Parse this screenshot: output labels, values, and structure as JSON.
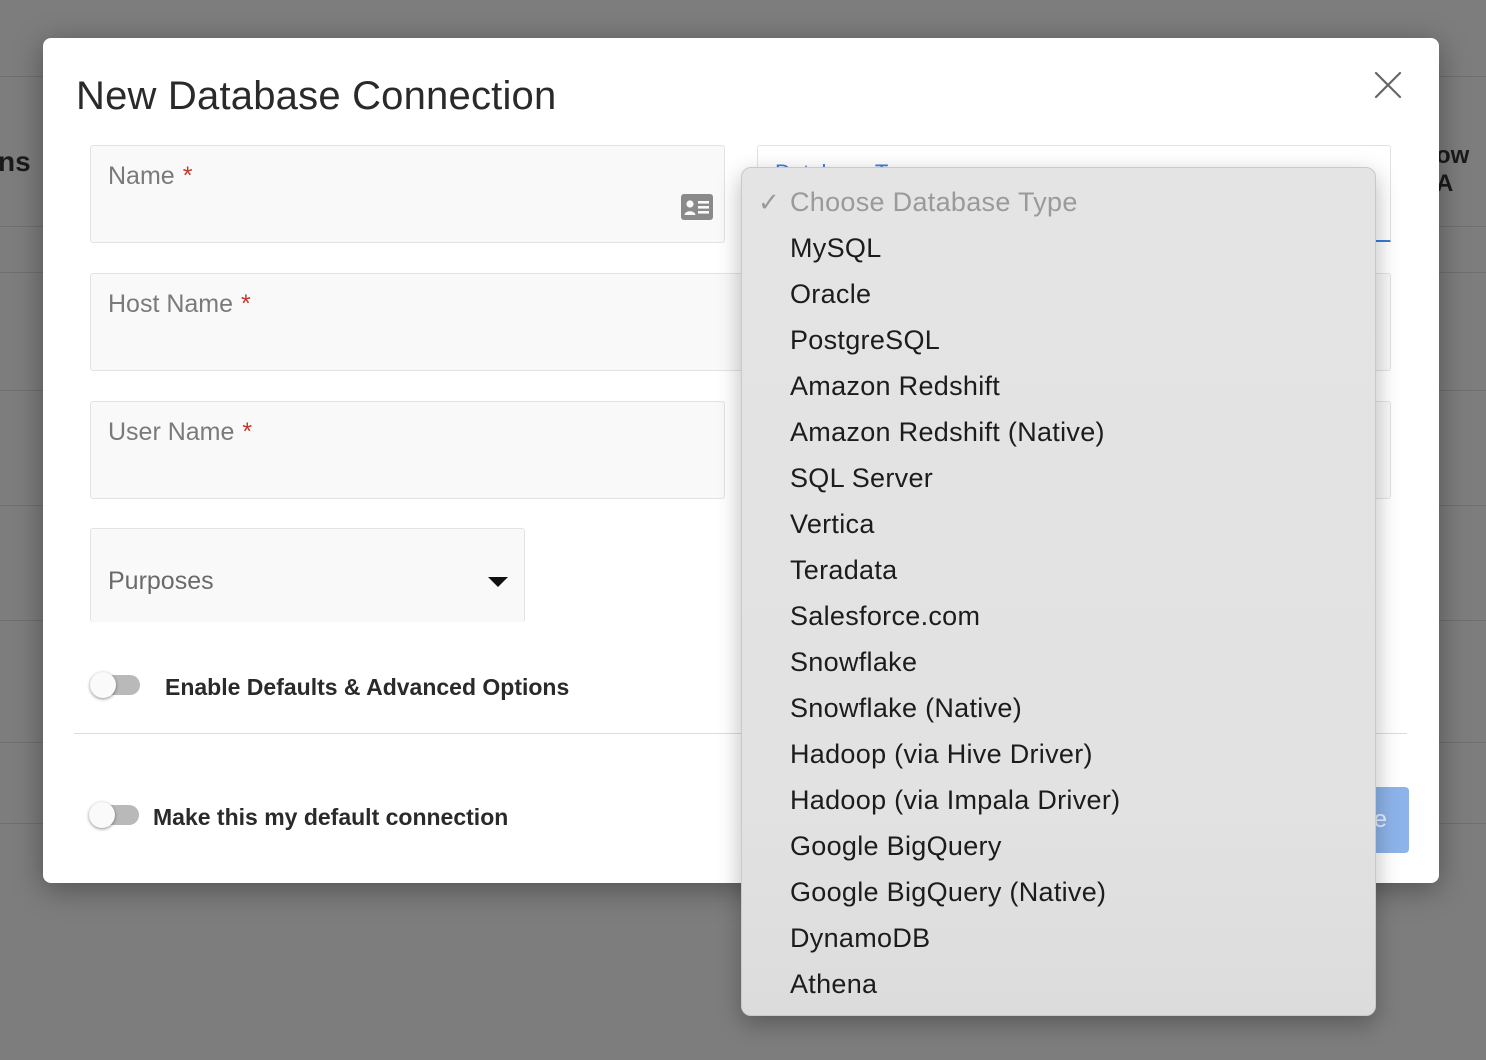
{
  "background": {
    "left_fragment": "ns",
    "right_fragment": "ow A"
  },
  "modal": {
    "title": "New Database Connection",
    "close_icon": "close-icon"
  },
  "form": {
    "name": {
      "label": "Name",
      "required": "*",
      "icon": "id-card-icon"
    },
    "host_name": {
      "label": "Host Name",
      "required": "*"
    },
    "user_name": {
      "label": "User Name",
      "required": "*"
    },
    "database_type": {
      "label": "Database Type"
    },
    "purposes": {
      "label": "Purposes"
    }
  },
  "toggles": {
    "advanced": {
      "label": "Enable Defaults & Advanced Options",
      "on": false
    },
    "default_connection": {
      "label": "Make this my default connection",
      "on": false
    }
  },
  "footer": {
    "save_label": "Save"
  },
  "dropdown": {
    "selected": "Choose Database Type",
    "check_glyph": "✓",
    "options": [
      "Choose Database Type",
      "MySQL",
      "Oracle",
      "PostgreSQL",
      "Amazon Redshift",
      "Amazon Redshift (Native)",
      "SQL Server",
      "Vertica",
      "Teradata",
      "Salesforce.com",
      "Snowflake",
      "Snowflake (Native)",
      "Hadoop (via Hive Driver)",
      "Hadoop (via Impala Driver)",
      "Google BigQuery",
      "Google BigQuery (Native)",
      "DynamoDB",
      "Athena"
    ]
  },
  "colors": {
    "overlay": "#7d7d7d",
    "required": "#c0392b",
    "accent": "#3b7bd8",
    "save_button": "#8db4ea"
  }
}
